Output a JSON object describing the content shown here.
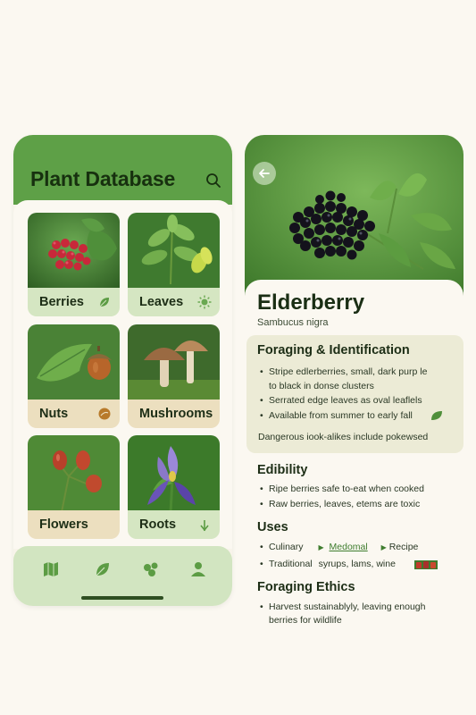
{
  "app": {
    "title": "Plant Database"
  },
  "categories": [
    {
      "label": "Berries",
      "icon": "leaf-icon"
    },
    {
      "label": "Leaves",
      "icon": "sun-icon"
    },
    {
      "label": "Nuts",
      "icon": "nut-icon"
    },
    {
      "label": "Mushrooms",
      "icon": ""
    },
    {
      "label": "Flowers",
      "icon": ""
    },
    {
      "label": "Roots",
      "icon": "sprout-icon"
    }
  ],
  "nav": [
    "map-icon",
    "leaf-icon",
    "sprout-icon",
    "profile-icon"
  ],
  "detail": {
    "name": "Elderberry",
    "scientific": "Sambucus nigra",
    "identification": {
      "title": "Foraging & Identification",
      "bullets": [
        "Stripe edlerberries, small, dark purp le",
        "to black in donse clusters",
        "Serrated edge leaves as oval leaflels",
        "Available from summer to early fall"
      ],
      "warning": "Dangerous iook-alikes include pokewsed"
    },
    "edibility": {
      "title": "Edibility",
      "bullets": [
        "Ripe berries safe to-eat when cooked",
        "Raw berries, leaves, etems are toxic"
      ]
    },
    "uses": {
      "title": "Uses",
      "row1": {
        "label": "Culinary",
        "link": "Medomal",
        "extra": "Recipe"
      },
      "row2": {
        "label": "Traditional",
        "extra": "syrups, lams, wine"
      }
    },
    "ethics": {
      "title": "Foraging Ethics",
      "lines": [
        "Harvest sustainablyly, leaving enough",
        "berries for wildlife"
      ]
    }
  },
  "colors": {
    "header_green": "#5ea047",
    "card_label_green": "#d5e6c2",
    "card_label_tan": "#ecdfbf",
    "panel": "#ecebd6"
  }
}
